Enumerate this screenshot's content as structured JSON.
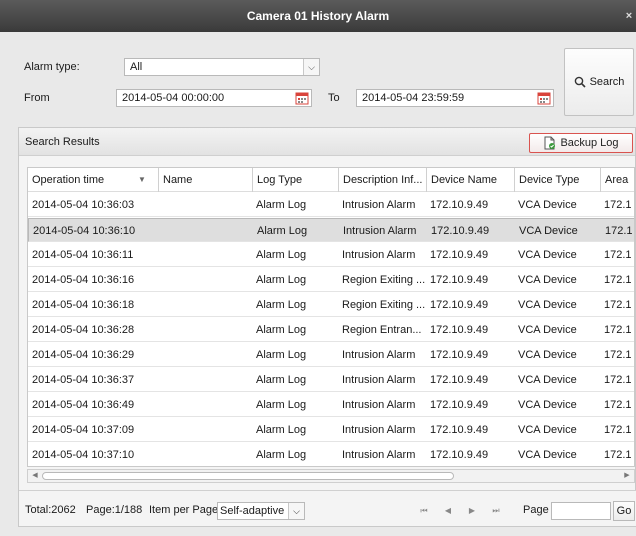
{
  "window": {
    "title": "Camera 01 History Alarm",
    "close_glyph": "×"
  },
  "filters": {
    "alarm_type_label": "Alarm type:",
    "alarm_type_value": "All",
    "from_label": "From",
    "from_value": "2014-05-04 00:00:00",
    "to_label": "To",
    "to_value": "2014-05-04 23:59:59",
    "search_label": "Search"
  },
  "results": {
    "title": "Search Results",
    "backup_label": "Backup Log",
    "columns": [
      "Operation time",
      "Name",
      "Log Type",
      "Description Inf...",
      "Device Name",
      "Device Type",
      "Area"
    ],
    "rows": [
      [
        "2014-05-04 10:36:03",
        "",
        "Alarm Log",
        "Intrusion Alarm",
        "172.10.9.49",
        "VCA Device",
        "172.1"
      ],
      [
        "2014-05-04 10:36:10",
        "",
        "Alarm Log",
        "Intrusion Alarm",
        "172.10.9.49",
        "VCA Device",
        "172.1"
      ],
      [
        "2014-05-04 10:36:11",
        "",
        "Alarm Log",
        "Intrusion Alarm",
        "172.10.9.49",
        "VCA Device",
        "172.1"
      ],
      [
        "2014-05-04 10:36:16",
        "",
        "Alarm Log",
        "Region Exiting ...",
        "172.10.9.49",
        "VCA Device",
        "172.1"
      ],
      [
        "2014-05-04 10:36:18",
        "",
        "Alarm Log",
        "Region Exiting ...",
        "172.10.9.49",
        "VCA Device",
        "172.1"
      ],
      [
        "2014-05-04 10:36:28",
        "",
        "Alarm Log",
        "Region Entran...",
        "172.10.9.49",
        "VCA Device",
        "172.1"
      ],
      [
        "2014-05-04 10:36:29",
        "",
        "Alarm Log",
        "Intrusion Alarm",
        "172.10.9.49",
        "VCA Device",
        "172.1"
      ],
      [
        "2014-05-04 10:36:37",
        "",
        "Alarm Log",
        "Intrusion Alarm",
        "172.10.9.49",
        "VCA Device",
        "172.1"
      ],
      [
        "2014-05-04 10:36:49",
        "",
        "Alarm Log",
        "Intrusion Alarm",
        "172.10.9.49",
        "VCA Device",
        "172.1"
      ],
      [
        "2014-05-04 10:37:09",
        "",
        "Alarm Log",
        "Intrusion Alarm",
        "172.10.9.49",
        "VCA Device",
        "172.1"
      ],
      [
        "2014-05-04 10:37:10",
        "",
        "Alarm Log",
        "Intrusion Alarm",
        "172.10.9.49",
        "VCA Device",
        "172.1"
      ]
    ],
    "selected_row": 1
  },
  "pager": {
    "total": "Total:2062",
    "page": "Page:1/188",
    "per_page_label": "Item per Page:",
    "per_page_value": "Self-adaptive",
    "page_label": "Page",
    "go_label": "Go"
  },
  "icons": {
    "calendar": "calendar-icon",
    "search": "magnifier-icon",
    "backup": "document-save-icon",
    "sort": "sort-down-icon"
  },
  "colors": {
    "titlebar": "#4a4a4a",
    "backup_border": "#d9534f",
    "selected_row": "#dedede",
    "calendar_red": "#d9443c"
  }
}
